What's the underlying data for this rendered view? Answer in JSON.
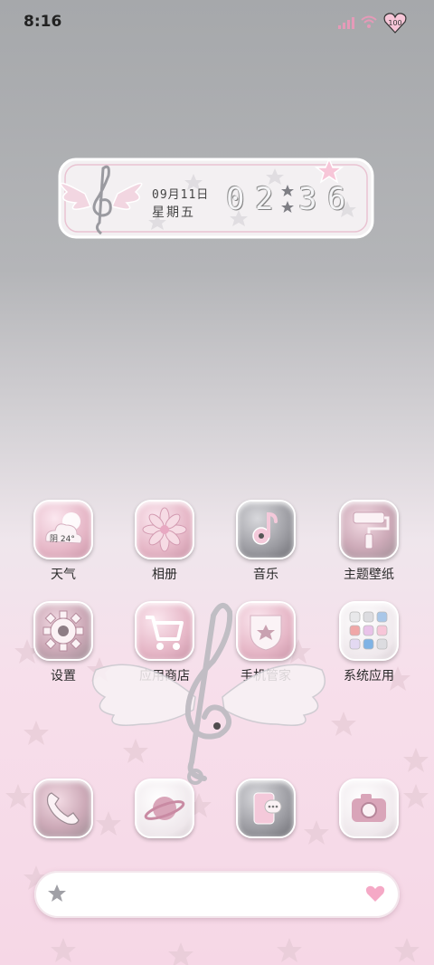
{
  "status_bar": {
    "time": "8:16",
    "battery": "100",
    "icons": [
      "signal-icon",
      "wifi-icon",
      "heart-battery-icon"
    ]
  },
  "widget": {
    "date": "09月11日",
    "weekday": "星期五",
    "hour_tens": "0",
    "hour_ones": "2",
    "minute_tens": "3",
    "minute_ones": "6"
  },
  "apps": [
    {
      "label": "天气",
      "icon": "weather-icon",
      "badge": "阴 24°"
    },
    {
      "label": "相册",
      "icon": "flower-icon"
    },
    {
      "label": "音乐",
      "icon": "music-note-icon"
    },
    {
      "label": "主题壁纸",
      "icon": "paint-roller-icon"
    },
    {
      "label": "设置",
      "icon": "gear-icon"
    },
    {
      "label": "应用商店",
      "icon": "shopping-cart-icon"
    },
    {
      "label": "手机管家",
      "icon": "shield-star-icon"
    },
    {
      "label": "系统应用",
      "icon": "app-folder-icon"
    }
  ],
  "dock": [
    {
      "icon": "phone-icon"
    },
    {
      "icon": "planet-icon"
    },
    {
      "icon": "message-icon"
    },
    {
      "icon": "camera-icon"
    }
  ],
  "search_bar": {
    "left_icon": "star-icon",
    "right_icon": "heart-icon"
  },
  "colors": {
    "accent_pink": "#e8a9c2",
    "tile_gray": "#8a8a90",
    "text": "#2a2a2a"
  }
}
